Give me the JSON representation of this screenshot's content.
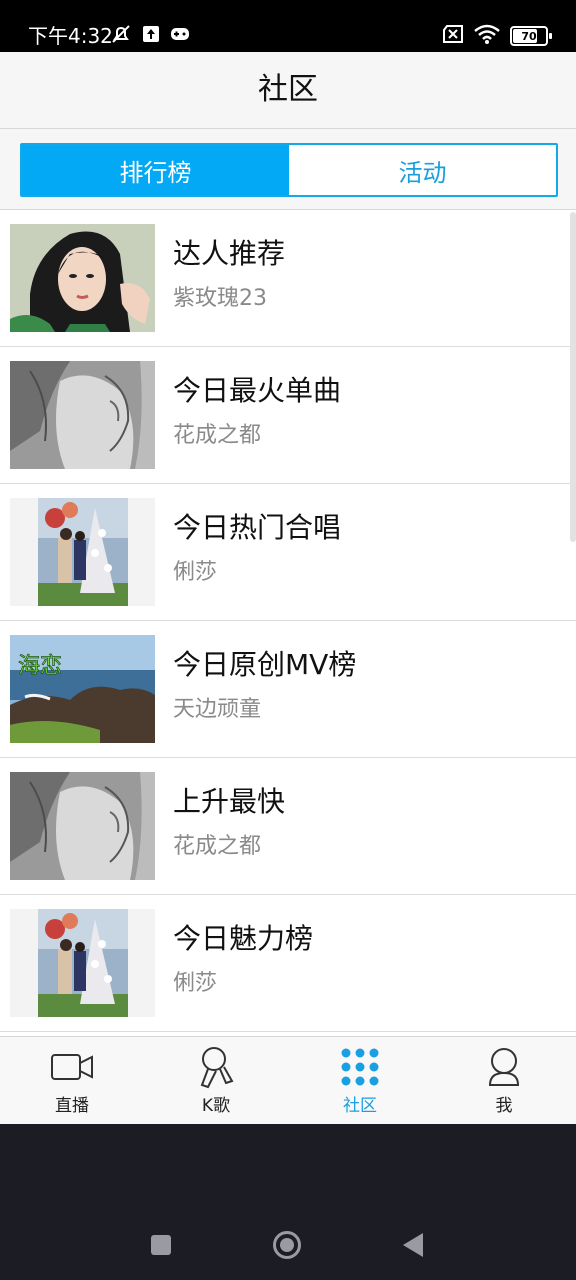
{
  "status_bar": {
    "time": "下午4:32",
    "battery": "70"
  },
  "header": {
    "title": "社区"
  },
  "segments": [
    {
      "label": "排行榜",
      "active": true
    },
    {
      "label": "活动",
      "active": false
    }
  ],
  "list": [
    {
      "title": "达人推荐",
      "subtitle": "紫玫瑰23"
    },
    {
      "title": "今日最火单曲",
      "subtitle": "花成之都"
    },
    {
      "title": "今日热门合唱",
      "subtitle": "俐莎"
    },
    {
      "title": "今日原创MV榜",
      "subtitle": "天边顽童"
    },
    {
      "title": "上升最快",
      "subtitle": "花成之都"
    },
    {
      "title": "今日魅力榜",
      "subtitle": "俐莎"
    }
  ],
  "bottom_nav": [
    {
      "label": "直播",
      "icon": "video-camera-icon",
      "active": false
    },
    {
      "label": "K歌",
      "icon": "microphone-icon",
      "active": false
    },
    {
      "label": "社区",
      "icon": "dots-grid-icon",
      "active": true
    },
    {
      "label": "我",
      "icon": "person-icon",
      "active": false
    }
  ],
  "colors": {
    "accent": "#03a9f4",
    "nav_active": "#1a9fe0",
    "subtitle": "#8a8a8a"
  }
}
